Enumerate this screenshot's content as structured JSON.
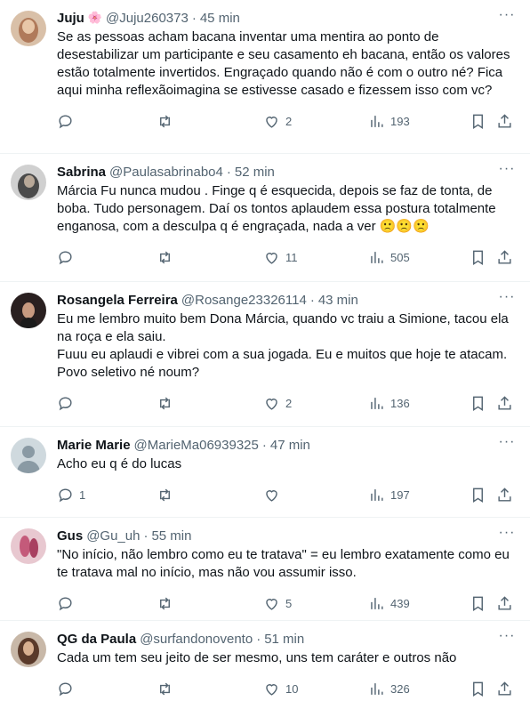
{
  "tweets": [
    {
      "name": "Juju",
      "emoji": "🌸",
      "handle": "@Juju260373",
      "time": "45 min",
      "text": "Se as pessoas acham bacana inventar uma mentira ao ponto de desestabilizar um participante e seu casamento eh bacana, então os valores estão totalmente invertidos. Engraçado quando não é com o outro né? Fica aqui minha reflexãoimagina se estivesse casado e fizessem isso com vc?",
      "replies": "",
      "retweets": "",
      "likes": "2",
      "views": "193",
      "avatar_color": "#b07a5a"
    },
    {
      "name": "Sabrina",
      "emoji": "",
      "handle": "@Paulasabrinabo4",
      "time": "52 min",
      "text": "Márcia Fu nunca mudou . Finge q é esquecida, depois se faz de tonta, de boba. Tudo personagem. Daí os tontos aplaudem essa postura totalmente enganosa, com a desculpa q é engraçada, nada a ver 🙁🙁🙁",
      "replies": "",
      "retweets": "",
      "likes": "11",
      "views": "505",
      "avatar_color": "#5a5a5a"
    },
    {
      "name": "Rosangela Ferreira",
      "emoji": "",
      "handle": "@Rosange23326114",
      "time": "43 min",
      "text": "Eu me lembro muito bem Dona Márcia, quando vc traiu a Simione, tacou ela na roça e ela saiu.\nFuuu eu aplaudi e vibrei com a sua jogada. Eu e muitos que hoje te atacam. Povo seletivo né noum?",
      "replies": "",
      "retweets": "",
      "likes": "2",
      "views": "136",
      "avatar_color": "#3a2a2a"
    },
    {
      "name": "Marie Marie",
      "emoji": "",
      "handle": "@MarieMa06939325",
      "time": "47 min",
      "text": "Acho eu q é do lucas",
      "replies": "1",
      "retweets": "",
      "likes": "",
      "views": "197",
      "avatar_color": "#cfd9de"
    },
    {
      "name": "Gus",
      "emoji": "",
      "handle": "@Gu_uh",
      "time": "55 min",
      "text": "\"No início, não lembro como eu te tratava\" = eu lembro exatamente como eu te tratava mal no início, mas não vou assumir isso.",
      "replies": "",
      "retweets": "",
      "likes": "5",
      "views": "439",
      "avatar_color": "#c45a7a"
    },
    {
      "name": "QG da Paula",
      "emoji": "",
      "handle": "@surfandonovento",
      "time": "51 min",
      "text": "Cada um tem seu jeito de ser mesmo, uns tem caráter e outros não",
      "replies": "",
      "retweets": "",
      "likes": "10",
      "views": "326",
      "avatar_color": "#6a4a3a"
    }
  ],
  "ui": {
    "more": "···",
    "separator": "·"
  },
  "icons": [
    "reply-icon",
    "retweet-icon",
    "like-icon",
    "views-icon",
    "bookmark-icon",
    "share-icon",
    "more-icon"
  ]
}
